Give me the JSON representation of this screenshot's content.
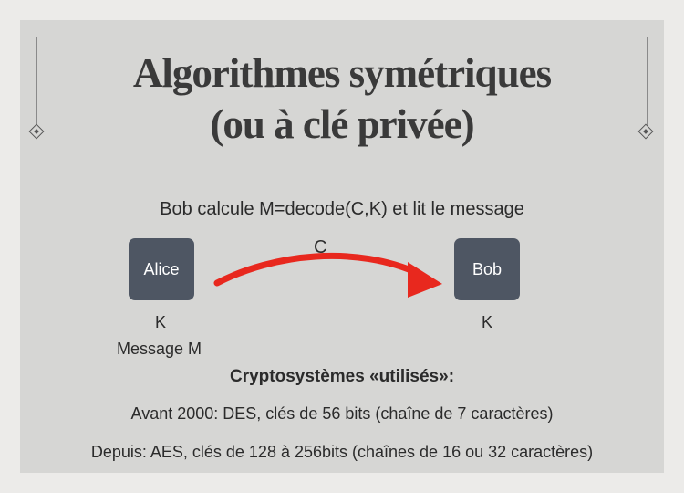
{
  "title": {
    "line1": "Algorithmes symétriques",
    "line2": "(ou à clé privée)"
  },
  "diagram": {
    "caption": "Bob calcule M=decode(C,K) et lit le message",
    "arrow_label": "C",
    "arrow_color": "#e8281e",
    "alice": {
      "label": "Alice",
      "key": "K",
      "message": "Message M"
    },
    "bob": {
      "label": "Bob",
      "key": "K"
    }
  },
  "systems": {
    "heading": "Cryptosystèmes «utilisés»:",
    "before": "Avant 2000: DES, clés de 56 bits (chaîne de 7 caractères)",
    "after": "Depuis: AES, clés de 128 à 256bits (chaînes de 16 ou 32 caractères)"
  }
}
